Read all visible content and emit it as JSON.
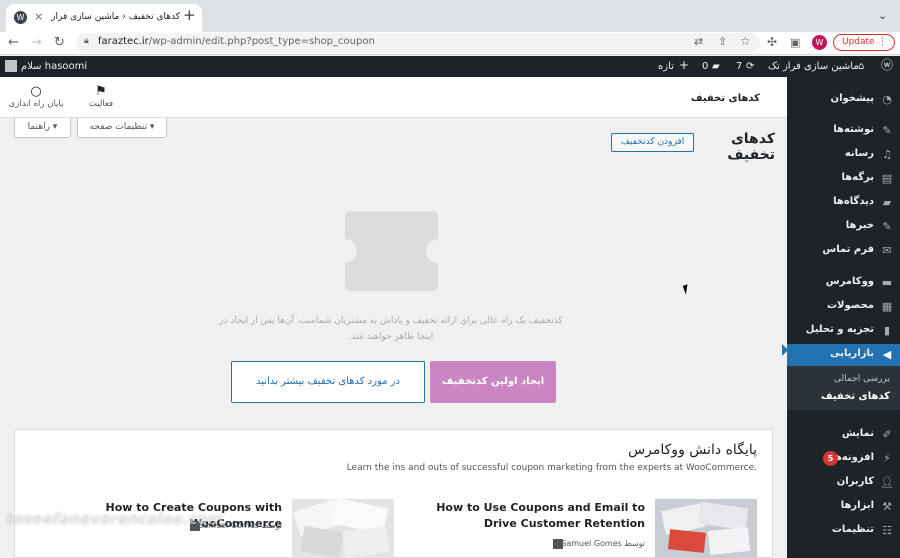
{
  "browser": {
    "tab_title": "کدهای تخفیف ‹ ماشین سازی فراز تک",
    "tab_close": "×",
    "new_tab": "+",
    "tab_menu": "⌄",
    "url_host": "faraztec.ir",
    "url_path": "/wp-admin/edit.php?post_type=shop_coupon",
    "profile_initial": "W",
    "update_label": "Update"
  },
  "adminbar": {
    "site_name": "ماشین سازی فراز تک",
    "updates_count": "7",
    "comments_count": "0",
    "new_label": "تازه",
    "greeting": "سلام hasoomi"
  },
  "sidebar": {
    "items": [
      {
        "label": "پیشخوان",
        "icon": "dashboard-icon"
      },
      {
        "label": "نوشته‌ها",
        "icon": "pin-icon"
      },
      {
        "label": "رسانه",
        "icon": "media-icon"
      },
      {
        "label": "برگه‌ها",
        "icon": "page-icon"
      },
      {
        "label": "دیدگاه‌ها",
        "icon": "comment-icon"
      },
      {
        "label": "خبرها",
        "icon": "pin-icon"
      },
      {
        "label": "فرم تماس",
        "icon": "mail-icon"
      },
      {
        "label": "ووکامرس",
        "icon": "woo-icon"
      },
      {
        "label": "محصولات",
        "icon": "archive-icon"
      },
      {
        "label": "تجزیه و تحلیل",
        "icon": "chart-icon"
      },
      {
        "label": "بازاریابی",
        "icon": "megaphone-icon"
      },
      {
        "label": "نمایش",
        "icon": "brush-icon"
      },
      {
        "label": "افزونه‌ها",
        "icon": "plugin-icon",
        "badge": "5"
      },
      {
        "label": "کاربران",
        "icon": "user-icon"
      },
      {
        "label": "ابزارها",
        "icon": "wrench-icon"
      },
      {
        "label": "تنظیمات",
        "icon": "settings-icon"
      }
    ],
    "submenu": {
      "overview": "بررسی اجمالی",
      "coupons": "کدهای تخفیف"
    }
  },
  "header": {
    "page_title": "کدهای تخفیف",
    "activity_label": "فعالیت",
    "finish_setup_label": "پایان راه اندازی"
  },
  "screen_options": {
    "options_label": "تنظیمات صفحه ▾",
    "help_label": "راهنما ▾"
  },
  "main": {
    "heading": "کدهای تخفیف",
    "add_button": "افزودن کدتخفیف",
    "empty_line1": "کدتخفیف یک راه عالی برای ارائه تخفیف و پاداش به مشتریان شماست. آن‌ها پس از ایجاد در",
    "empty_line2": "اینجا ظاهر خواهند شد.",
    "create_button": "ایجاد اولین کدتخفیف",
    "learn_button": "در مورد کدهای تخفیف بیشتر بدانید"
  },
  "knowledge_base": {
    "title": "پایگاه دانش ووکامرس",
    "subtitle": "Learn the ins and outs of successful coupon marketing from the experts at WooCommerce.",
    "articles": [
      {
        "title": "How to Use Coupons and Email to Drive Customer Retention",
        "by_prefix": "توسط",
        "author": "Samuel Gomes"
      },
      {
        "title": "How to Create Coupons with WooCommerce",
        "by_prefix": "توسط",
        "author": "Samuel Gomes"
      }
    ]
  },
  "watermark": "toseefanavarancalee.com",
  "colors": {
    "admin_dark": "#1d2327",
    "accent_blue": "#2271b1",
    "woo_purple": "#c986c3",
    "badge_red": "#d63638"
  }
}
